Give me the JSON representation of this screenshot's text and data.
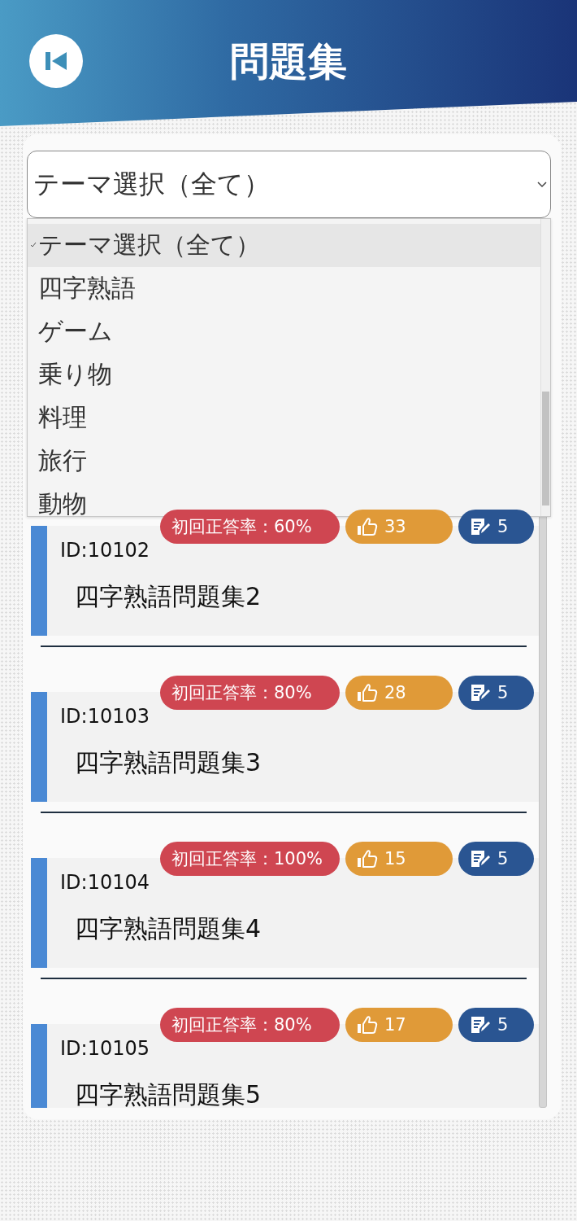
{
  "header": {
    "title": "問題集"
  },
  "theme_select": {
    "value": "テーマ選択（全て）",
    "expanded": true,
    "options": [
      {
        "label": "テーマ選択（全て）",
        "selected": true
      },
      {
        "label": "四字熟語",
        "selected": false
      },
      {
        "label": "ゲーム",
        "selected": false
      },
      {
        "label": "乗り物",
        "selected": false
      },
      {
        "label": "料理",
        "selected": false
      },
      {
        "label": "旅行",
        "selected": false
      },
      {
        "label": "動物",
        "selected": false
      }
    ]
  },
  "cards": [
    {
      "id_label": "ID:10102",
      "title": "四字熟語問題集2",
      "accuracy": "初回正答率：60%",
      "likes": "33",
      "questions": "5"
    },
    {
      "id_label": "ID:10103",
      "title": "四字熟語問題集3",
      "accuracy": "初回正答率：80%",
      "likes": "28",
      "questions": "5"
    },
    {
      "id_label": "ID:10104",
      "title": "四字熟語問題集4",
      "accuracy": "初回正答率：100%",
      "likes": "15",
      "questions": "5"
    },
    {
      "id_label": "ID:10105",
      "title": "四字熟語問題集5",
      "accuracy": "初回正答率：80%",
      "likes": "17",
      "questions": "5"
    }
  ]
}
